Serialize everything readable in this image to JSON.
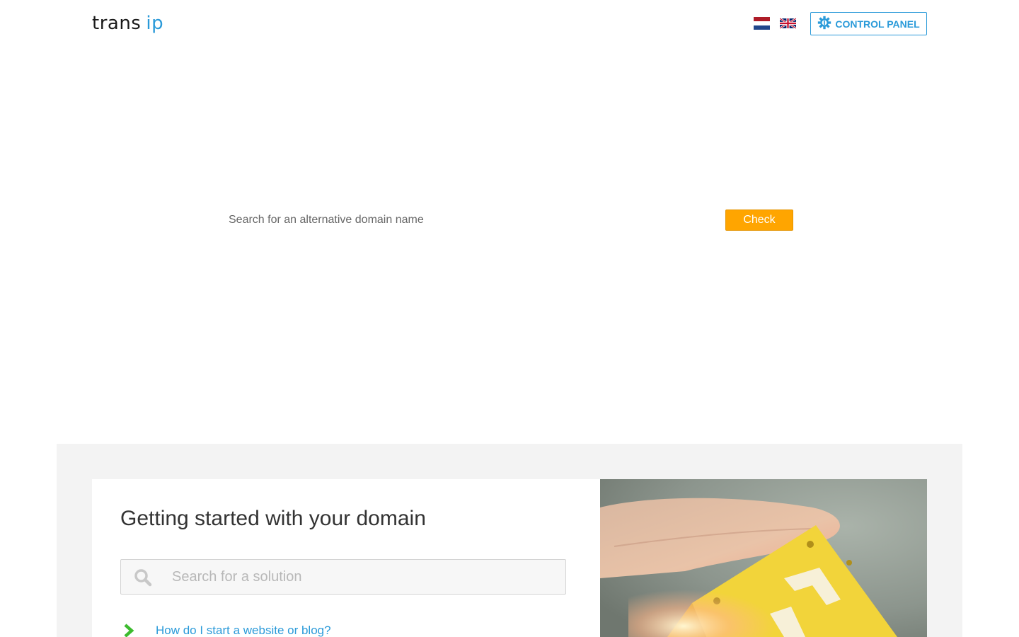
{
  "header": {
    "logo": {
      "part1": "trans",
      "part2": "ip"
    },
    "languages": [
      {
        "code": "nl",
        "name": "Nederlands"
      },
      {
        "code": "en",
        "name": "English"
      }
    ],
    "control_panel_label": "CONTROL PANEL"
  },
  "domain_search": {
    "placeholder": "Search for an alternative domain name",
    "button_label": "Check"
  },
  "getting_started": {
    "title": "Getting started with your domain",
    "search_placeholder": "Search for a solution",
    "faq": [
      {
        "label": "How do I start a website or blog?"
      }
    ]
  },
  "colors": {
    "brand_blue": "#2a9ad9",
    "accent_orange": "#ffa500",
    "faq_chevron_green": "#3dbb2e",
    "band_gray": "#f3f3f3"
  },
  "icons": {
    "control_panel": "gear-icon",
    "solution_search": "search-icon",
    "faq_item": "chevron-right-icon"
  }
}
